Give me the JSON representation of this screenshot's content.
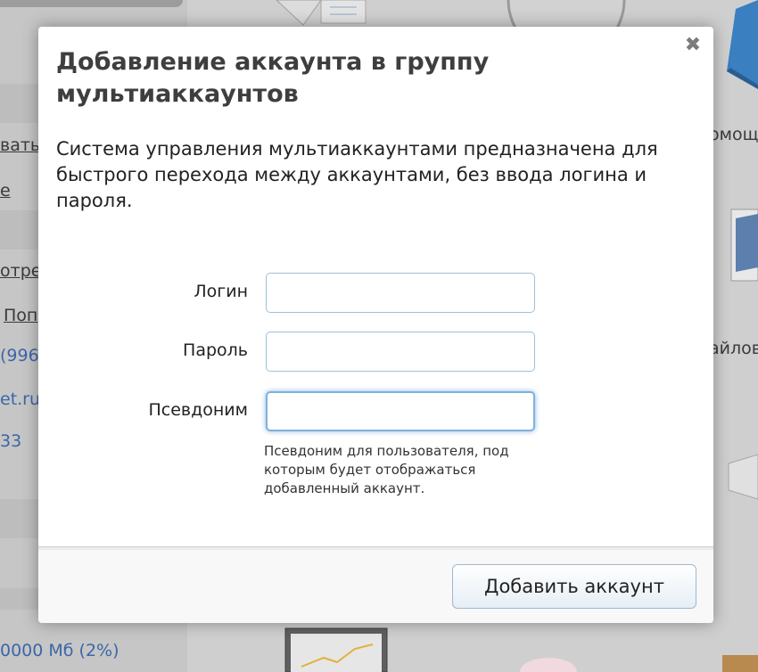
{
  "background": {
    "left_links": [
      "вать",
      "е",
      "отре",
      "Поп"
    ],
    "left_blue": [
      "(996",
      "et.ru",
      "33",
      "0000 Мб (2%)"
    ],
    "right_labels": [
      "омощ",
      "айлов"
    ]
  },
  "modal": {
    "title": "Добавление аккаунта в группу мультиаккаунтов",
    "description": "Система управления мультиаккаунтами предназначена для быстрого перехода между аккаунтами, без ввода логина и пароля.",
    "close_symbol": "✖",
    "fields": {
      "login": {
        "label": "Логин",
        "value": ""
      },
      "password": {
        "label": "Пароль",
        "value": ""
      },
      "alias": {
        "label": "Псевдоним",
        "value": ""
      }
    },
    "alias_hint": "Псевдоним для пользователя, под которым будет отображаться добавленный аккаунт.",
    "submit_label": "Добавить аккаунт"
  },
  "colors": {
    "input_border": "#9ec0d9",
    "focus_glow": "#7fb1dd",
    "link_blue": "#3c66a8"
  }
}
